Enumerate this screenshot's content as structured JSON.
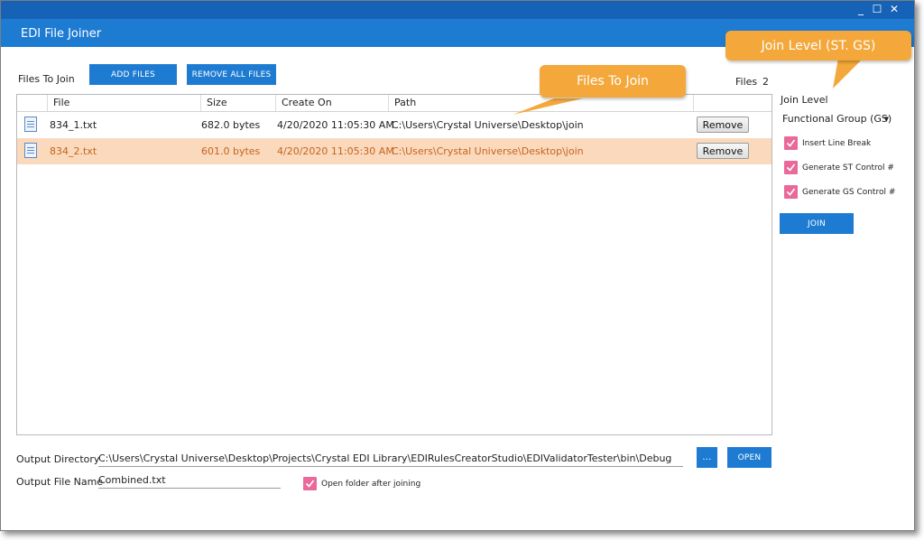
{
  "window": {
    "title": "EDI File Joiner",
    "controls": {
      "minimize": "_",
      "maximize": "☐",
      "close": "✕"
    }
  },
  "toolbar": {
    "files_to_join_label": "Files To Join",
    "add_files": "ADD FILES",
    "remove_all_files": "REMOVE ALL FILES",
    "files_count_label": "Files",
    "files_count": "2"
  },
  "grid": {
    "columns": [
      "File",
      "Size",
      "Create On",
      "Path"
    ],
    "rows": [
      {
        "file": "834_1.txt",
        "size": "682.0 bytes",
        "created": "4/20/2020 11:05:30 AM",
        "path": "C:\\Users\\Crystal Universe\\Desktop\\join",
        "action": "Remove",
        "selected": false
      },
      {
        "file": "834_2.txt",
        "size": "601.0 bytes",
        "created": "4/20/2020 11:05:30 AM",
        "path": "C:\\Users\\Crystal Universe\\Desktop\\join",
        "action": "Remove",
        "selected": true
      }
    ]
  },
  "callouts": {
    "files_to_join": "Files To Join",
    "join_level": "Join Level (ST. GS)"
  },
  "options": {
    "join_level_label": "Join Level",
    "join_level_value": "Functional Group (GS)",
    "insert_line_break": {
      "label": "Insert Line Break",
      "checked": true
    },
    "generate_st": {
      "label": "Generate ST Control #",
      "checked": true
    },
    "generate_gs": {
      "label": "Generate GS Control #",
      "checked": true
    },
    "join_button": "JOIN"
  },
  "output": {
    "directory_label": "Output Directory",
    "directory_value": "C:\\Users\\Crystal Universe\\Desktop\\Projects\\Crystal EDI Library\\EDIRulesCreatorStudio\\EDIValidatorTester\\bin\\Debug",
    "browse_button": "...",
    "open_button": "OPEN",
    "file_name_label": "Output File Name",
    "file_name_value": "Combined.txt",
    "open_folder": {
      "label": "Open folder after joining",
      "checked": true
    }
  },
  "colors": {
    "titlebar": "#1662b7",
    "header": "#1e7bd2",
    "accent_button": "#1e7bd2",
    "selected_row": "#fbd9bd",
    "selected_text": "#c5641c",
    "checkbox": "#e8699a",
    "callout": "#f4a83b"
  }
}
